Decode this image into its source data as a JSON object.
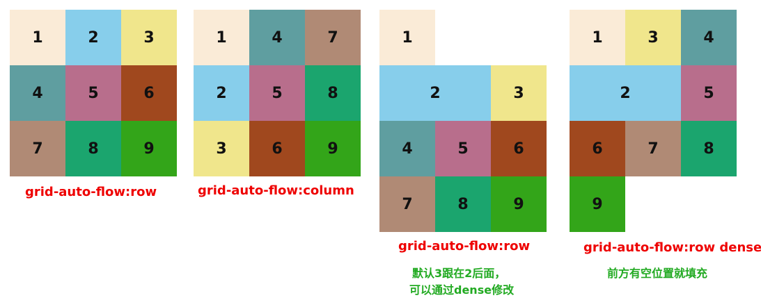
{
  "colors": {
    "1": "#FAEBD7",
    "2": "#87CEEB",
    "3": "#F0E68C",
    "4": "#5F9EA0",
    "5": "#B86E8C",
    "6": "#A0481E",
    "7": "#B08A75",
    "8": "#1BA56E",
    "9": "#33A519"
  },
  "diagrams": [
    {
      "caption": "grid-auto-flow:row",
      "cells": [
        {
          "label": "1",
          "col": 1,
          "row": 1,
          "span": 1
        },
        {
          "label": "2",
          "col": 2,
          "row": 1,
          "span": 1
        },
        {
          "label": "3",
          "col": 3,
          "row": 1,
          "span": 1
        },
        {
          "label": "4",
          "col": 1,
          "row": 2,
          "span": 1
        },
        {
          "label": "5",
          "col": 2,
          "row": 2,
          "span": 1
        },
        {
          "label": "6",
          "col": 3,
          "row": 2,
          "span": 1
        },
        {
          "label": "7",
          "col": 1,
          "row": 3,
          "span": 1
        },
        {
          "label": "8",
          "col": 2,
          "row": 3,
          "span": 1
        },
        {
          "label": "9",
          "col": 3,
          "row": 3,
          "span": 1
        }
      ]
    },
    {
      "caption": "grid-auto-flow:column",
      "cells": [
        {
          "label": "1",
          "col": 1,
          "row": 1,
          "span": 1
        },
        {
          "label": "4",
          "col": 2,
          "row": 1,
          "span": 1
        },
        {
          "label": "7",
          "col": 3,
          "row": 1,
          "span": 1
        },
        {
          "label": "2",
          "col": 1,
          "row": 2,
          "span": 1
        },
        {
          "label": "5",
          "col": 2,
          "row": 2,
          "span": 1
        },
        {
          "label": "8",
          "col": 3,
          "row": 2,
          "span": 1
        },
        {
          "label": "3",
          "col": 1,
          "row": 3,
          "span": 1
        },
        {
          "label": "6",
          "col": 2,
          "row": 3,
          "span": 1
        },
        {
          "label": "9",
          "col": 3,
          "row": 3,
          "span": 1
        }
      ]
    },
    {
      "caption": "grid-auto-flow:row",
      "note": [
        "默认3跟在2后面，",
        "可以通过dense修改"
      ],
      "cells": [
        {
          "label": "1",
          "col": 1,
          "row": 1,
          "span": 1
        },
        {
          "label": "2",
          "col": 1,
          "row": 2,
          "span": 2
        },
        {
          "label": "3",
          "col": 3,
          "row": 2,
          "span": 1
        },
        {
          "label": "4",
          "col": 1,
          "row": 3,
          "span": 1
        },
        {
          "label": "5",
          "col": 2,
          "row": 3,
          "span": 1
        },
        {
          "label": "6",
          "col": 3,
          "row": 3,
          "span": 1
        },
        {
          "label": "7",
          "col": 1,
          "row": 4,
          "span": 1
        },
        {
          "label": "8",
          "col": 2,
          "row": 4,
          "span": 1
        },
        {
          "label": "9",
          "col": 3,
          "row": 4,
          "span": 1
        }
      ]
    },
    {
      "caption": "grid-auto-flow:row dense",
      "note": [
        "前方有空位置就填充"
      ],
      "cells": [
        {
          "label": "1",
          "col": 1,
          "row": 1,
          "span": 1
        },
        {
          "label": "3",
          "col": 2,
          "row": 1,
          "span": 1
        },
        {
          "label": "4",
          "col": 3,
          "row": 1,
          "span": 1
        },
        {
          "label": "2",
          "col": 1,
          "row": 2,
          "span": 2
        },
        {
          "label": "5",
          "col": 3,
          "row": 2,
          "span": 1
        },
        {
          "label": "6",
          "col": 1,
          "row": 3,
          "span": 1
        },
        {
          "label": "7",
          "col": 2,
          "row": 3,
          "span": 1
        },
        {
          "label": "8",
          "col": 3,
          "row": 3,
          "span": 1
        },
        {
          "label": "9",
          "col": 1,
          "row": 4,
          "span": 1
        }
      ]
    }
  ]
}
